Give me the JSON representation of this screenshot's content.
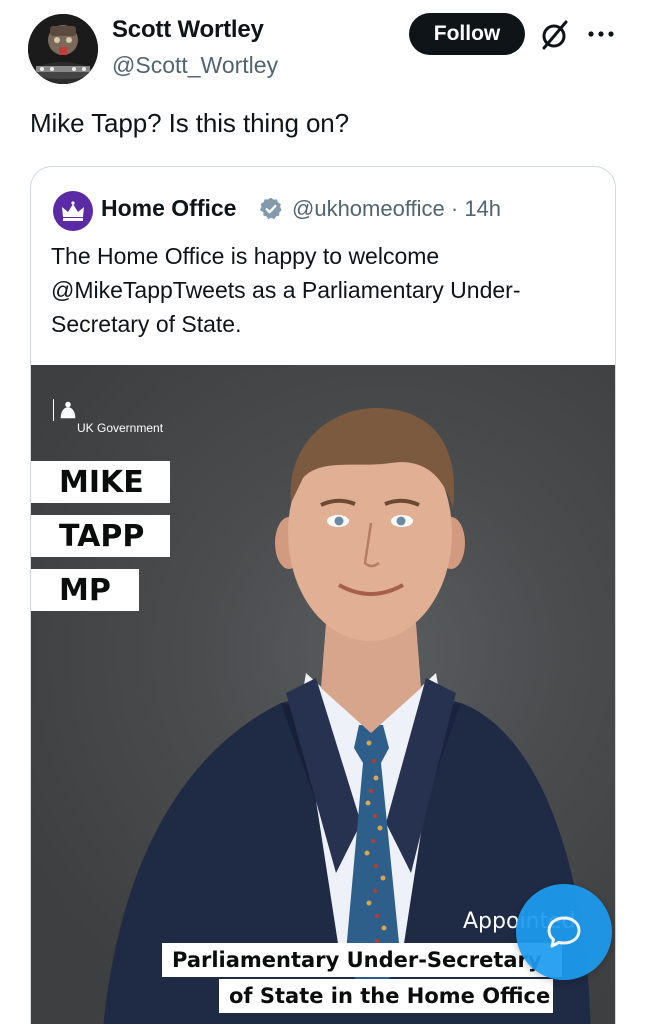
{
  "author": {
    "name": "Scott Wortley",
    "handle": "@Scott_Wortley",
    "follow_label": "Follow"
  },
  "icons": {
    "grok": "grok-icon",
    "more": "more-dots-icon",
    "verified": "verified-badge-icon",
    "chat": "chat-bubble-icon"
  },
  "tweet": {
    "text": "Mike Tapp? Is this thing on?"
  },
  "quote": {
    "name": "Home Office",
    "handle_time": "@ukhomeoffice · 14h",
    "text": "The Home Office is happy to welcome @MikeTappTweets as a Parliamentary Under-Secretary of State.",
    "media": {
      "gov_label": "UK Government",
      "name_lines": [
        "MIKE",
        "TAPP",
        "MP"
      ],
      "appointed": "Appointed",
      "caption_line1": "Parliamentary Under-Secretary",
      "caption_line2": "of State in the Home Office"
    }
  },
  "colors": {
    "primary_text": "#0f1419",
    "secondary_text": "#536471",
    "follow_bg": "#0f1419",
    "verified": "#829aab",
    "home_office_purple": "#5b2aa5",
    "fab_blue": "#1d9bf0"
  }
}
